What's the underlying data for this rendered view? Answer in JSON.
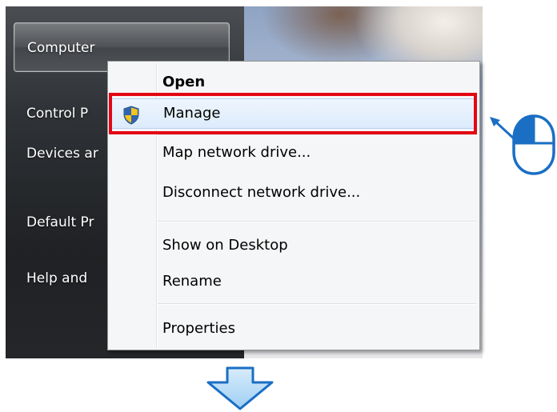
{
  "start_menu": {
    "items": [
      {
        "label": "Computer"
      },
      {
        "label": "Control P"
      },
      {
        "label": "Devices ar"
      },
      {
        "label": "Default Pr"
      },
      {
        "label": "Help and"
      }
    ]
  },
  "context_menu": {
    "items": [
      {
        "label": "Open"
      },
      {
        "label": "Manage",
        "icon": "uac-shield-icon"
      },
      {
        "label": "Map network drive..."
      },
      {
        "label": "Disconnect network drive..."
      },
      {
        "label": "Show on Desktop"
      },
      {
        "label": "Rename"
      },
      {
        "label": "Properties"
      }
    ]
  },
  "annotations": {
    "highlight_color": "#e30613",
    "arrow_color": "#1a6fc4",
    "mouse_icon": "mouse-left-click-icon",
    "down_arrow_icon": "down-arrow-icon"
  }
}
